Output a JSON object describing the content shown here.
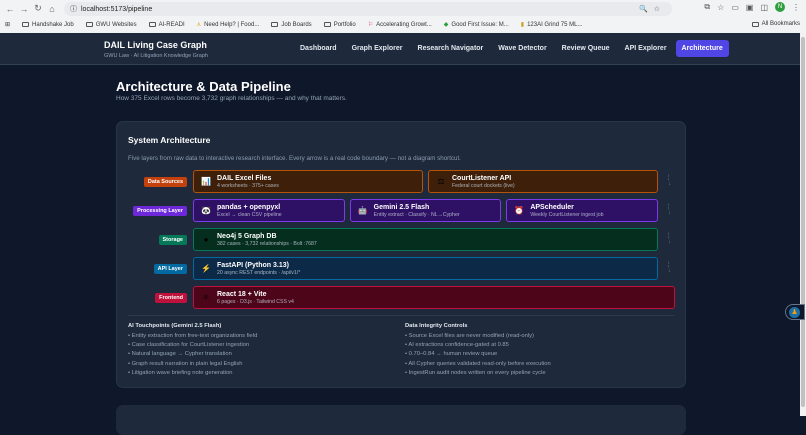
{
  "browser": {
    "url": "localhost:5173/pipeline",
    "profile": "N",
    "bookmarks": [
      "Handshake Job",
      "GWU Websites",
      "AI-READI",
      "Need Help? | Food...",
      "Job Boards",
      "Portfolio",
      "Accelerating Growt...",
      "Good First Issue: M...",
      "123AI Grind 75 ML..."
    ],
    "all_bookmarks": "All Bookmarks"
  },
  "header": {
    "title": "DAIL Living Case Graph",
    "subtitle": "GWU Law · AI Litigation Knowledge Graph",
    "nav": [
      "Dashboard",
      "Graph Explorer",
      "Research Navigator",
      "Wave Detector",
      "Review Queue",
      "API Explorer",
      "Architecture"
    ],
    "active": "Architecture"
  },
  "page": {
    "title": "Architecture & Data Pipeline",
    "subtitle": "How 375 Excel rows become 3,732 graph relationships — and why that matters."
  },
  "card": {
    "title": "System Architecture",
    "description": "Five layers from raw data to interactive research interface. Every arrow is a real code boundary — not a diagram shortcut.",
    "layers": [
      {
        "label": "Data Sources",
        "color": "#c2410c",
        "items": [
          {
            "icon": "📊",
            "title": "DAIL Excel Files",
            "sub": "4 worksheets · 375+ cases"
          },
          {
            "icon": "⚖",
            "title": "CourtListener API",
            "sub": "Federal court dockets (live)"
          }
        ]
      },
      {
        "label": "Processing Layer",
        "color": "#6d28d9",
        "items": [
          {
            "icon": "🐼",
            "title": "pandas + openpyxl",
            "sub": "Excel → clean CSV pipeline"
          },
          {
            "icon": "🤖",
            "title": "Gemini 2.5 Flash",
            "sub": "Entity extract · Classify · NL→Cypher"
          },
          {
            "icon": "⏰",
            "title": "APScheduler",
            "sub": "Weekly CourtListener ingest job"
          }
        ]
      },
      {
        "label": "Storage",
        "color": "#047857",
        "items": [
          {
            "icon": "●",
            "title": "Neo4j 5 Graph DB",
            "sub": "382 cases · 3,732 relationships · Bolt :7687"
          }
        ]
      },
      {
        "label": "API Layer",
        "color": "#0369a1",
        "items": [
          {
            "icon": "⚡",
            "title": "FastAPI (Python 3.13)",
            "sub": "20 async REST endpoints · /api/v1/*"
          }
        ]
      },
      {
        "label": "Frontend",
        "color": "#be123c",
        "items": [
          {
            "icon": "⚛",
            "title": "React 18 + Vite",
            "sub": "6 pages · D3.js · Tailwind CSS v4"
          }
        ]
      }
    ],
    "ai_title": "AI Touchpoints (Gemini 2.5 Flash)",
    "ai_items": [
      "Entity extraction from free-text organizations field",
      "Case classification for CourtListener ingestion",
      "Natural language → Cypher translation",
      "Graph result narration in plain legal English",
      "Litigation wave briefing note generation"
    ],
    "integrity_title": "Data Integrity Controls",
    "integrity_items": [
      "Source Excel files are never modified (read-only)",
      "AI extractions confidence-gated at 0.85",
      "0.70–0.84 → human review queue",
      "All Cypher queries validated read-only before execution",
      "IngestRun audit nodes written on every pipeline cycle"
    ]
  }
}
